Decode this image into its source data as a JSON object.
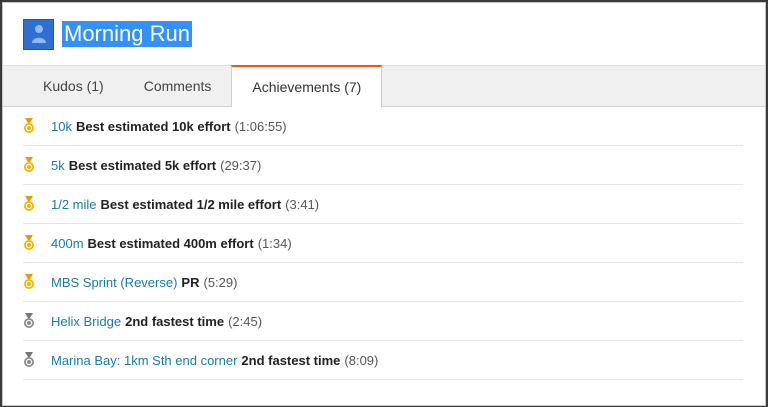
{
  "activity": {
    "title": "Morning Run"
  },
  "tabs": [
    {
      "label": "Kudos (1)"
    },
    {
      "label": "Comments"
    },
    {
      "label": "Achievements (7)",
      "active": true
    }
  ],
  "achievements": [
    {
      "medal": "gold-medal-icon",
      "name": "10k",
      "desc": "Best estimated 10k effort",
      "time": "(1:06:55)"
    },
    {
      "medal": "gold-medal-icon",
      "name": "5k",
      "desc": "Best estimated 5k effort",
      "time": "(29:37)"
    },
    {
      "medal": "gold-medal-icon",
      "name": "1/2 mile",
      "desc": "Best estimated 1/2 mile effort",
      "time": "(3:41)"
    },
    {
      "medal": "gold-medal-icon",
      "name": "400m",
      "desc": "Best estimated 400m effort",
      "time": "(1:34)"
    },
    {
      "medal": "gold-medal-icon",
      "name": "MBS Sprint (Reverse)",
      "desc": "PR",
      "time": "(5:29)"
    },
    {
      "medal": "silver-medal-icon",
      "name": "Helix Bridge",
      "desc": "2nd fastest time",
      "time": "(2:45)"
    },
    {
      "medal": "silver-medal-icon",
      "name": "Marina Bay: 1km Sth end corner",
      "desc": "2nd fastest time",
      "time": "(8:09)"
    }
  ],
  "colors": {
    "gold": "#f5b400",
    "silver": "#8a8a8a",
    "link": "#1b7ba6",
    "tab_accent": "#fc5200",
    "title_highlight": "#3390ff"
  }
}
